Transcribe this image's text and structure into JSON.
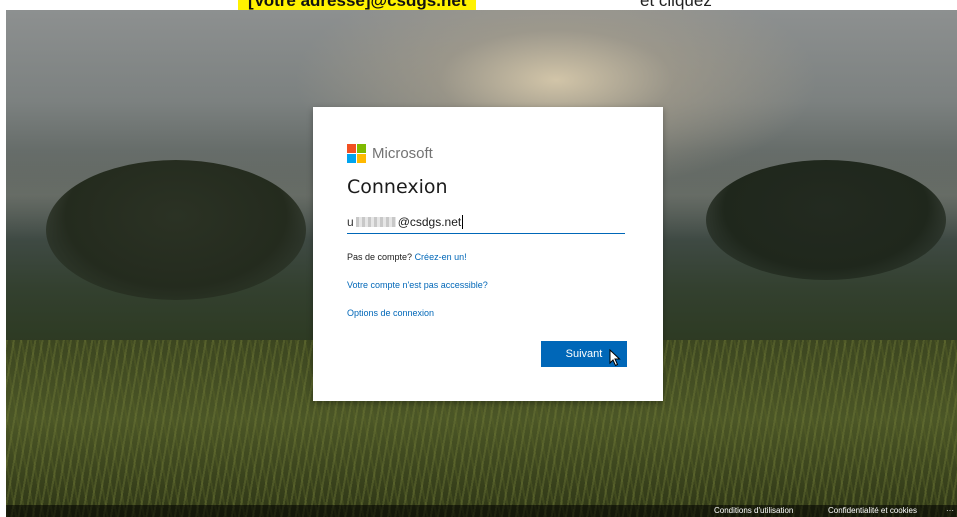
{
  "caption": {
    "highlight_text": "[Votre adresse]@csdgs.net",
    "rest_text": "et cliquez"
  },
  "card": {
    "brand_name": "Microsoft",
    "title": "Connexion",
    "email": {
      "prefix": "u",
      "suffix": "@csdgs.net"
    },
    "no_account_text": "Pas de compte?",
    "create_account_link": "Créez-en un!",
    "cant_access_link": "Votre compte n'est pas accessible?",
    "signin_options_link": "Options de connexion",
    "next_button": "Suivant"
  },
  "logo_colors": [
    "#f25022",
    "#7fba00",
    "#00a4ef",
    "#ffb900"
  ],
  "accent_color": "#0067b8",
  "highlight_color": "#fff200",
  "footer": {
    "terms": "Conditions d'utilisation",
    "privacy": "Confidentialité et cookies",
    "more": "···"
  }
}
